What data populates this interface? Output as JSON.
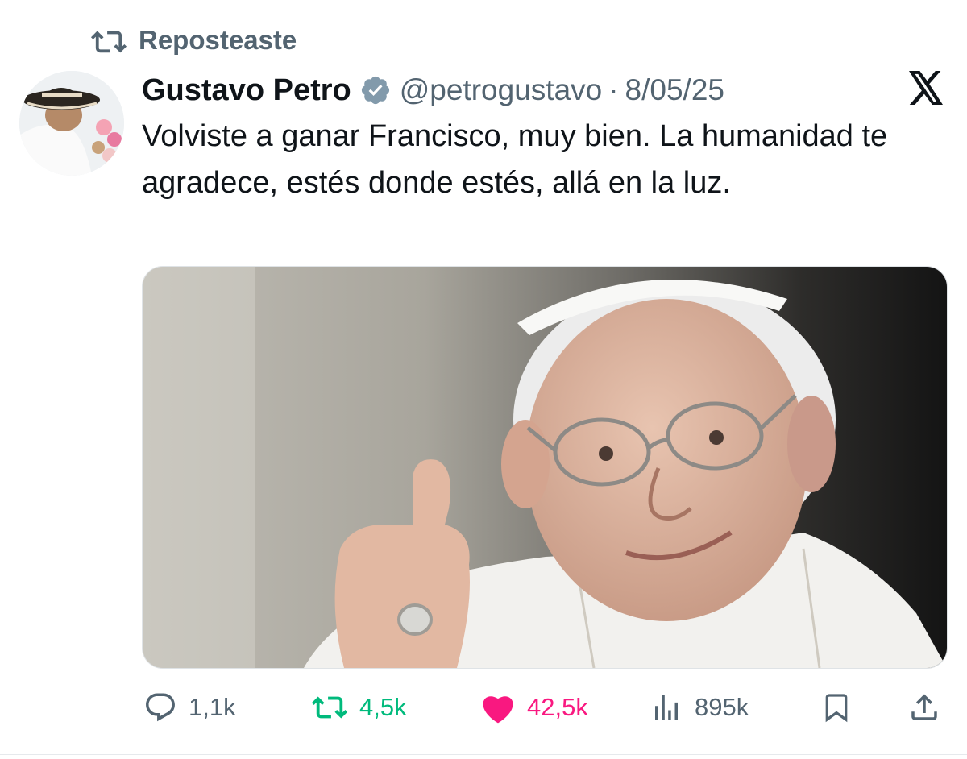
{
  "repost_label": "Reposteaste",
  "author": {
    "name": "Gustavo Petro",
    "handle": "@petrogustavo",
    "separator": "·",
    "date": "8/05/25"
  },
  "tweet_text": "Volviste a ganar Francisco, muy bien. La humanidad te agradece, estés donde estés, allá en la luz.",
  "actions": {
    "replies": "1,1k",
    "reposts": "4,5k",
    "likes": "42,5k",
    "views": "895k"
  },
  "icons": {
    "repost": "repost-icon",
    "verified": "verified-badge-icon",
    "platform": "x-logo-icon",
    "reply": "reply-icon",
    "like": "heart-icon",
    "views": "views-icon",
    "bookmark": "bookmark-icon",
    "share": "share-icon"
  },
  "colors": {
    "text_primary": "#0f1419",
    "text_secondary": "#536471",
    "repost_active": "#00ba7c",
    "like_active": "#f91880"
  }
}
